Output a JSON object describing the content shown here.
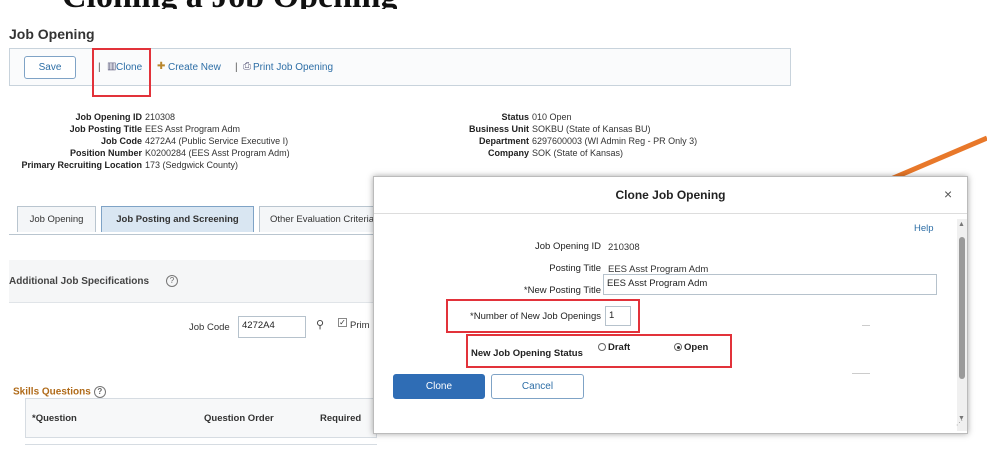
{
  "page": {
    "title": "Job Opening",
    "toolbar": {
      "save": "Save",
      "clone": "Clone",
      "create_new": "Create New",
      "print": "Print Job Opening",
      "separator": "|"
    },
    "details": {
      "job_opening_id": {
        "label": "Job Opening ID",
        "value": "210308"
      },
      "job_posting_title": {
        "label": "Job Posting Title",
        "value": "EES Asst Program Adm"
      },
      "job_code": {
        "label": "Job Code",
        "value": "4272A4 (Public Service Executive I)"
      },
      "position_number": {
        "label": "Position Number",
        "value": "K0200284 (EES Asst Program Adm)"
      },
      "primary_location": {
        "label": "Primary Recruiting Location",
        "value": "173 (Sedgwick County)"
      },
      "status": {
        "label": "Status",
        "value": "010 Open"
      },
      "business_unit": {
        "label": "Business Unit",
        "value": "SOKBU (State of Kansas BU)"
      },
      "department": {
        "label": "Department",
        "value": "6297600003 (WI Admin Reg - PR Only 3)"
      },
      "company": {
        "label": "Company",
        "value": "SOK (State of Kansas)"
      }
    },
    "tabs": [
      "Job Opening",
      "Job Posting and Screening",
      "Other Evaluation Criteria"
    ],
    "section": {
      "title": "Additional Job Specifications",
      "help": "?",
      "job_code_label": "Job Code",
      "job_code_value": "4272A4",
      "prim_label": "Prim",
      "skills_title": "Skills Questions",
      "columns": [
        "*Question",
        "Question Order",
        "Required"
      ]
    }
  },
  "modal": {
    "title": "Clone Job Opening",
    "close": "×",
    "help": "Help",
    "job_opening_id_label": "Job Opening ID",
    "job_opening_id_value": "210308",
    "posting_title_label": "Posting Title",
    "posting_title_value": "EES Asst Program Adm",
    "new_posting_title_label": "*New Posting Title",
    "new_posting_title_value": "EES Asst Program Adm",
    "num_openings_label": "*Number of New Job Openings",
    "num_openings_value": "1",
    "status_label": "New Job Opening Status",
    "status_options": [
      "Draft",
      "Open"
    ],
    "status_selected": "Open",
    "clone_btn": "Clone",
    "cancel_btn": "Cancel"
  },
  "colors": {
    "highlight": "#e2323a",
    "arrow": "#e8782a",
    "primary_button": "#2f6db5"
  },
  "top_cut_text": "Cloning a Job Opening"
}
